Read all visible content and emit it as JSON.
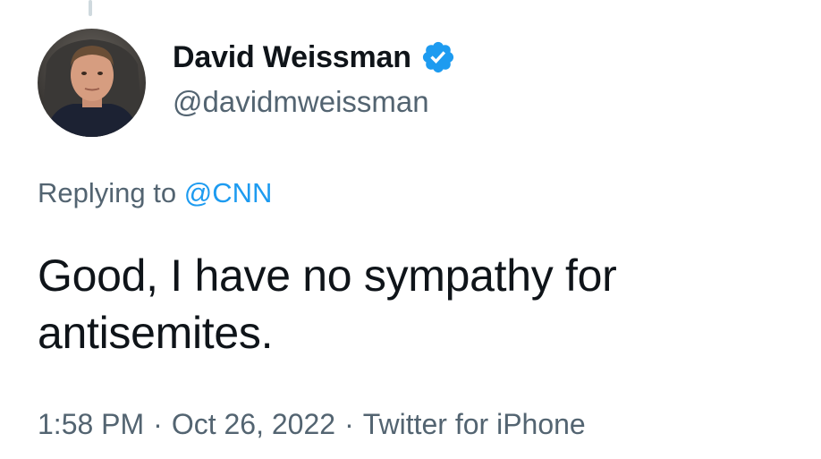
{
  "author": {
    "display_name": "David Weissman",
    "handle": "@davidmweissman",
    "verified": true,
    "avatar_icon": "profile-photo"
  },
  "reply": {
    "prefix": "Replying to",
    "mention": "@CNN"
  },
  "tweet": {
    "text": "Good, I have no sympathy for antisemites."
  },
  "meta": {
    "time": "1:58 PM",
    "separator": "·",
    "date": "Oct 26, 2022",
    "source": "Twitter for iPhone"
  },
  "colors": {
    "text_primary": "#0f1419",
    "text_secondary": "#536471",
    "link": "#1d9bf0",
    "verified": "#1d9bf0"
  }
}
